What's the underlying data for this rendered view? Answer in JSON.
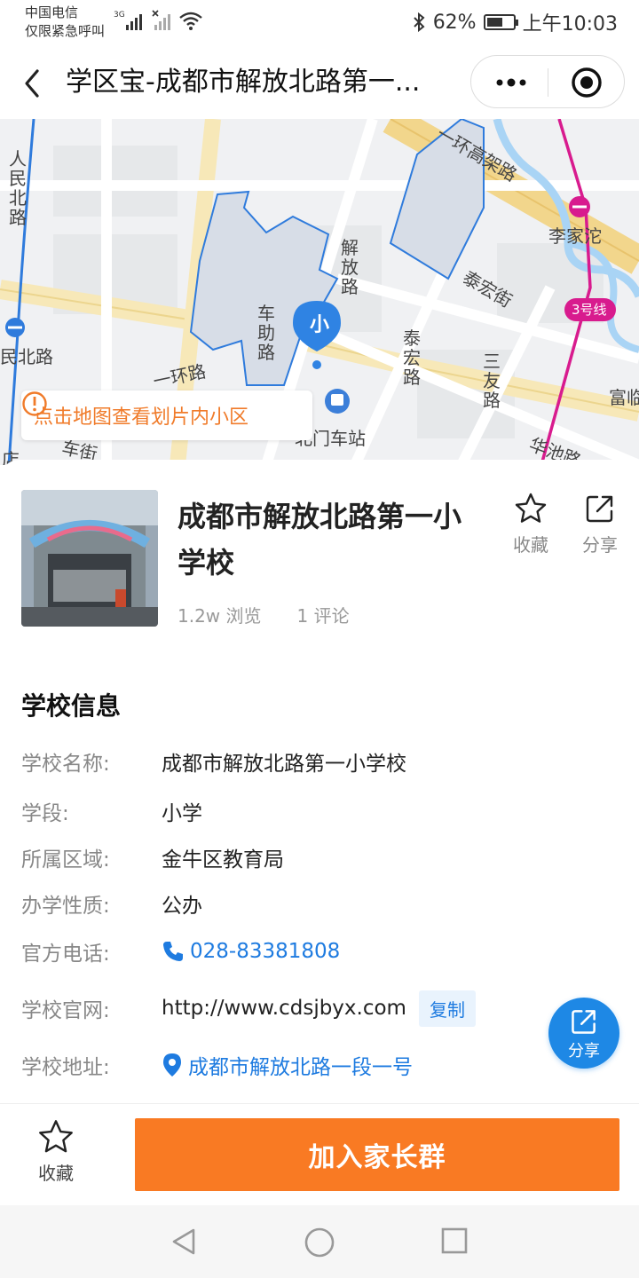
{
  "status_bar": {
    "carrier_line1": "中国电信",
    "carrier_line2": "仅限紧急呼叫",
    "network": "3G",
    "battery": "62%",
    "battery_level": 0.62,
    "time": "上午10:03"
  },
  "nav": {
    "title": "学区宝-成都市解放北路第一..."
  },
  "map": {
    "labels": {
      "renmin": "人民北路",
      "minbei": "民北路",
      "yihuan": "一环路",
      "gaojia": "一环高架路",
      "lijiatuo": "李家沱",
      "line3": "3号线",
      "taihong_jie": "泰宏街",
      "jiefang": "解放路",
      "cheqi": "车助路",
      "taihong_lu": "泰宏路",
      "sanyou": "三友路",
      "beimen": "北门车站",
      "fu": "富临",
      "jie": "车街",
      "dian": "店",
      "huachi": "华池路"
    },
    "pin_label": "小",
    "tip": "点击地图查看划片内小区"
  },
  "school": {
    "name": "成都市解放北路第一小学校",
    "views": "1.2w 浏览",
    "comments": "1 评论",
    "fav_label": "收藏",
    "share_label": "分享"
  },
  "info": {
    "section_title": "学校信息",
    "rows": [
      {
        "key": "学校名称:",
        "value": "成都市解放北路第一小学校"
      },
      {
        "key": "学段:",
        "value": "小学"
      },
      {
        "key": "所属区域:",
        "value": "金牛区教育局"
      },
      {
        "key": "办学性质:",
        "value": "公办"
      },
      {
        "key": "官方电话:",
        "value": "028-83381808"
      },
      {
        "key": "学校官网:",
        "value": "http://www.cdsjbyx.com"
      },
      {
        "key": "学校地址:",
        "value": "成都市解放北路一段一号"
      }
    ],
    "copy_label": "复制"
  },
  "float_share": {
    "label": "分享"
  },
  "bottom_bar": {
    "fav_label": "收藏",
    "join_label": "加入家长群"
  },
  "colors": {
    "accent_orange": "#f97a23",
    "link_blue": "#1e7be0",
    "metro_magenta": "#d81b8e"
  },
  "icons": [
    "back-icon",
    "more-icon",
    "target-icon",
    "info-icon",
    "star-icon",
    "share-icon",
    "phone-icon",
    "location-icon",
    "bus-icon"
  ]
}
